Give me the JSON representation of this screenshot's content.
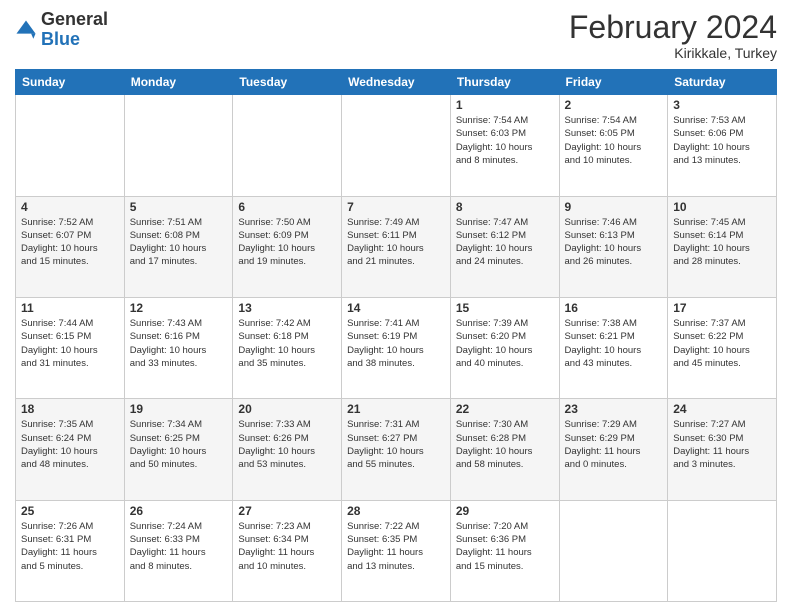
{
  "logo": {
    "general": "General",
    "blue": "Blue"
  },
  "title": "February 2024",
  "location": "Kirikkale, Turkey",
  "days_of_week": [
    "Sunday",
    "Monday",
    "Tuesday",
    "Wednesday",
    "Thursday",
    "Friday",
    "Saturday"
  ],
  "weeks": [
    [
      {
        "day": "",
        "info": ""
      },
      {
        "day": "",
        "info": ""
      },
      {
        "day": "",
        "info": ""
      },
      {
        "day": "",
        "info": ""
      },
      {
        "day": "1",
        "info": "Sunrise: 7:54 AM\nSunset: 6:03 PM\nDaylight: 10 hours\nand 8 minutes."
      },
      {
        "day": "2",
        "info": "Sunrise: 7:54 AM\nSunset: 6:05 PM\nDaylight: 10 hours\nand 10 minutes."
      },
      {
        "day": "3",
        "info": "Sunrise: 7:53 AM\nSunset: 6:06 PM\nDaylight: 10 hours\nand 13 minutes."
      }
    ],
    [
      {
        "day": "4",
        "info": "Sunrise: 7:52 AM\nSunset: 6:07 PM\nDaylight: 10 hours\nand 15 minutes."
      },
      {
        "day": "5",
        "info": "Sunrise: 7:51 AM\nSunset: 6:08 PM\nDaylight: 10 hours\nand 17 minutes."
      },
      {
        "day": "6",
        "info": "Sunrise: 7:50 AM\nSunset: 6:09 PM\nDaylight: 10 hours\nand 19 minutes."
      },
      {
        "day": "7",
        "info": "Sunrise: 7:49 AM\nSunset: 6:11 PM\nDaylight: 10 hours\nand 21 minutes."
      },
      {
        "day": "8",
        "info": "Sunrise: 7:47 AM\nSunset: 6:12 PM\nDaylight: 10 hours\nand 24 minutes."
      },
      {
        "day": "9",
        "info": "Sunrise: 7:46 AM\nSunset: 6:13 PM\nDaylight: 10 hours\nand 26 minutes."
      },
      {
        "day": "10",
        "info": "Sunrise: 7:45 AM\nSunset: 6:14 PM\nDaylight: 10 hours\nand 28 minutes."
      }
    ],
    [
      {
        "day": "11",
        "info": "Sunrise: 7:44 AM\nSunset: 6:15 PM\nDaylight: 10 hours\nand 31 minutes."
      },
      {
        "day": "12",
        "info": "Sunrise: 7:43 AM\nSunset: 6:16 PM\nDaylight: 10 hours\nand 33 minutes."
      },
      {
        "day": "13",
        "info": "Sunrise: 7:42 AM\nSunset: 6:18 PM\nDaylight: 10 hours\nand 35 minutes."
      },
      {
        "day": "14",
        "info": "Sunrise: 7:41 AM\nSunset: 6:19 PM\nDaylight: 10 hours\nand 38 minutes."
      },
      {
        "day": "15",
        "info": "Sunrise: 7:39 AM\nSunset: 6:20 PM\nDaylight: 10 hours\nand 40 minutes."
      },
      {
        "day": "16",
        "info": "Sunrise: 7:38 AM\nSunset: 6:21 PM\nDaylight: 10 hours\nand 43 minutes."
      },
      {
        "day": "17",
        "info": "Sunrise: 7:37 AM\nSunset: 6:22 PM\nDaylight: 10 hours\nand 45 minutes."
      }
    ],
    [
      {
        "day": "18",
        "info": "Sunrise: 7:35 AM\nSunset: 6:24 PM\nDaylight: 10 hours\nand 48 minutes."
      },
      {
        "day": "19",
        "info": "Sunrise: 7:34 AM\nSunset: 6:25 PM\nDaylight: 10 hours\nand 50 minutes."
      },
      {
        "day": "20",
        "info": "Sunrise: 7:33 AM\nSunset: 6:26 PM\nDaylight: 10 hours\nand 53 minutes."
      },
      {
        "day": "21",
        "info": "Sunrise: 7:31 AM\nSunset: 6:27 PM\nDaylight: 10 hours\nand 55 minutes."
      },
      {
        "day": "22",
        "info": "Sunrise: 7:30 AM\nSunset: 6:28 PM\nDaylight: 10 hours\nand 58 minutes."
      },
      {
        "day": "23",
        "info": "Sunrise: 7:29 AM\nSunset: 6:29 PM\nDaylight: 11 hours\nand 0 minutes."
      },
      {
        "day": "24",
        "info": "Sunrise: 7:27 AM\nSunset: 6:30 PM\nDaylight: 11 hours\nand 3 minutes."
      }
    ],
    [
      {
        "day": "25",
        "info": "Sunrise: 7:26 AM\nSunset: 6:31 PM\nDaylight: 11 hours\nand 5 minutes."
      },
      {
        "day": "26",
        "info": "Sunrise: 7:24 AM\nSunset: 6:33 PM\nDaylight: 11 hours\nand 8 minutes."
      },
      {
        "day": "27",
        "info": "Sunrise: 7:23 AM\nSunset: 6:34 PM\nDaylight: 11 hours\nand 10 minutes."
      },
      {
        "day": "28",
        "info": "Sunrise: 7:22 AM\nSunset: 6:35 PM\nDaylight: 11 hours\nand 13 minutes."
      },
      {
        "day": "29",
        "info": "Sunrise: 7:20 AM\nSunset: 6:36 PM\nDaylight: 11 hours\nand 15 minutes."
      },
      {
        "day": "",
        "info": ""
      },
      {
        "day": "",
        "info": ""
      }
    ]
  ]
}
